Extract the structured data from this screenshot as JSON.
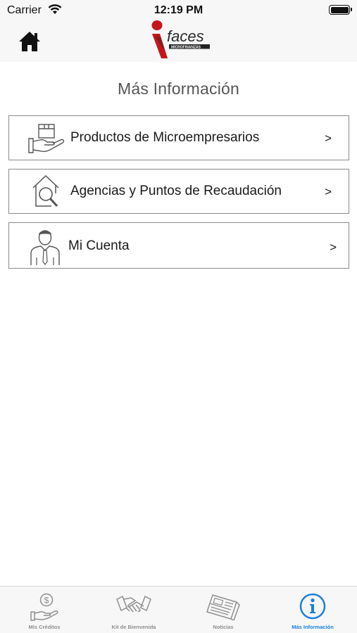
{
  "status_bar": {
    "carrier": "Carrier",
    "time": "12:19 PM"
  },
  "header": {
    "home_icon": "home-icon",
    "logo_text": "faces",
    "logo_subtext": "MICROFINANZAS"
  },
  "page": {
    "title": "Más Información"
  },
  "menu": [
    {
      "label": "Productos de Microempresarios",
      "chevron": ">",
      "icon": "box-hand-icon"
    },
    {
      "label": "Agencias y Puntos de Recaudación",
      "chevron": ">",
      "icon": "house-search-icon"
    },
    {
      "label": "Mi Cuenta",
      "chevron": ">",
      "icon": "person-icon"
    }
  ],
  "tab_bar": {
    "tabs": [
      {
        "label": "Mis Créditos",
        "icon": "money-hand-icon",
        "active": false
      },
      {
        "label": "Kit de Bienvenida",
        "icon": "handshake-icon",
        "active": false
      },
      {
        "label": "Noticias",
        "icon": "newspaper-icon",
        "active": false
      },
      {
        "label": "Más Información",
        "icon": "info-icon",
        "active": true
      }
    ]
  },
  "colors": {
    "accent": "#1a7fe0",
    "brand_red": "#c4161c",
    "inactive_tab": "#8e8e8e",
    "border": "#8a8a8a"
  }
}
